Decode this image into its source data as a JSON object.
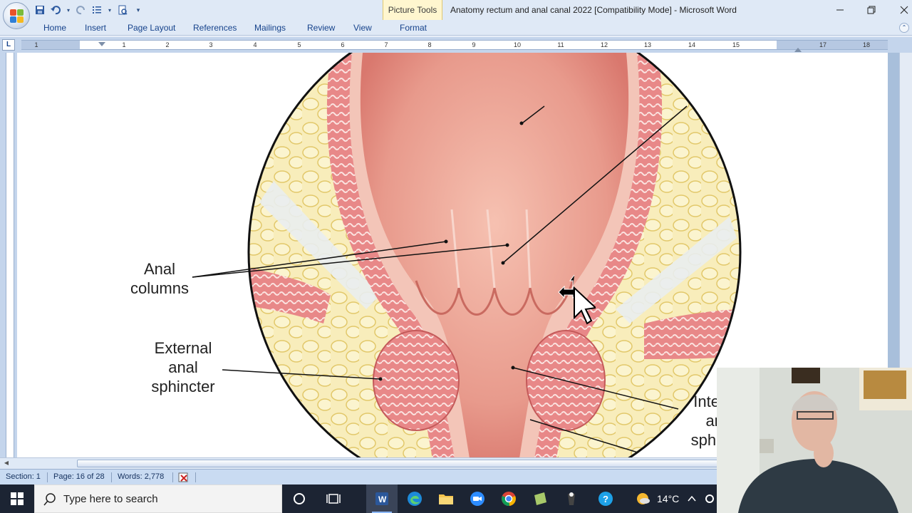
{
  "titlebar": {
    "contextual_tab": "Picture Tools",
    "title": "Anatomy rectum and anal canal 2022 [Compatibility Mode] - Microsoft Word",
    "qat": [
      "save-icon",
      "undo-icon",
      "redo-icon",
      "list-icon",
      "print-preview-icon",
      "customize-icon"
    ]
  },
  "ribbon": {
    "tabs": [
      "Home",
      "Insert",
      "Page Layout",
      "References",
      "Mailings",
      "Review",
      "View",
      "Format"
    ]
  },
  "ruler": {
    "numbers": [
      "1",
      "1",
      "2",
      "3",
      "4",
      "5",
      "6",
      "7",
      "8",
      "9",
      "10",
      "11",
      "12",
      "13",
      "14",
      "15",
      "17",
      "18"
    ]
  },
  "figure": {
    "labels": {
      "anal_columns": [
        "Anal",
        "columns"
      ],
      "external_sphincter": [
        "External",
        "anal",
        "sphincter"
      ],
      "internal_sphincter": [
        "Inte",
        "ar",
        "sphi"
      ]
    }
  },
  "statusbar": {
    "section": "Section: 1",
    "page": "Page: 16 of 28",
    "words": "Words: 2,778"
  },
  "taskbar": {
    "search_placeholder": "Type here to search",
    "temperature": "14°C"
  },
  "colors": {
    "ribbon_bg": "#dfe9f6",
    "tab_text": "#15428b",
    "taskbar_bg": "#1c2433",
    "tissue": "#f0a09a",
    "fat": "#f7e9a8"
  }
}
